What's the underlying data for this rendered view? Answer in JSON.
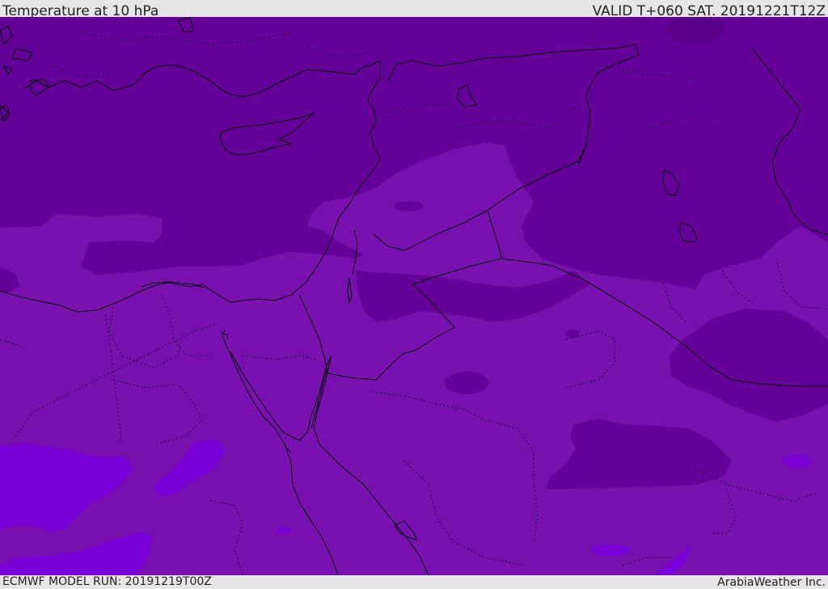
{
  "header": {
    "title": "Temperature at 10 hPa",
    "valid": "VALID T+060 SAT. 20191221T12Z"
  },
  "footer": {
    "model_run": "ECMWF MODEL RUN: 20191219T00Z",
    "credit": "ArabiaWeather Inc."
  },
  "colors": {
    "background_field": "#7811b0",
    "cold_field": "#640198",
    "warm_field": "#7a00d8",
    "coastline": "#000000",
    "border": "#1a0033"
  }
}
